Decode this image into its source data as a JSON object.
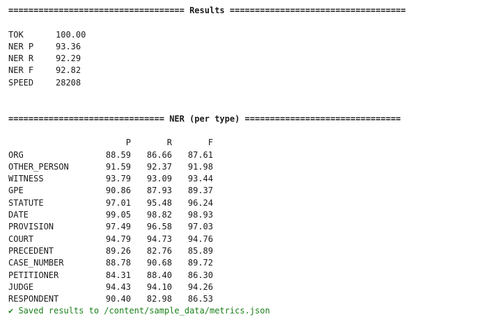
{
  "results_banner": "=================================== Results ===================================",
  "metrics": [
    {
      "key": "TOK",
      "value": "100.00"
    },
    {
      "key": "NER P",
      "value": "93.36"
    },
    {
      "key": "NER R",
      "value": "92.29"
    },
    {
      "key": "NER F",
      "value": "92.82"
    },
    {
      "key": "SPEED",
      "value": "28208"
    }
  ],
  "ner_banner": "=============================== NER (per type) ===============================",
  "per_type": {
    "headers": [
      "P",
      "R",
      "F"
    ],
    "rows": [
      {
        "label": "ORG",
        "p": "88.59",
        "r": "86.66",
        "f": "87.61"
      },
      {
        "label": "OTHER_PERSON",
        "p": "91.59",
        "r": "92.37",
        "f": "91.98"
      },
      {
        "label": "WITNESS",
        "p": "93.79",
        "r": "93.09",
        "f": "93.44"
      },
      {
        "label": "GPE",
        "p": "90.86",
        "r": "87.93",
        "f": "89.37"
      },
      {
        "label": "STATUTE",
        "p": "97.01",
        "r": "95.48",
        "f": "96.24"
      },
      {
        "label": "DATE",
        "p": "99.05",
        "r": "98.82",
        "f": "98.93"
      },
      {
        "label": "PROVISION",
        "p": "97.49",
        "r": "96.58",
        "f": "97.03"
      },
      {
        "label": "COURT",
        "p": "94.79",
        "r": "94.73",
        "f": "94.76"
      },
      {
        "label": "PRECEDENT",
        "p": "89.26",
        "r": "82.76",
        "f": "85.89"
      },
      {
        "label": "CASE_NUMBER",
        "p": "88.78",
        "r": "90.68",
        "f": "89.72"
      },
      {
        "label": "PETITIONER",
        "p": "84.31",
        "r": "88.40",
        "f": "86.30"
      },
      {
        "label": "JUDGE",
        "p": "94.43",
        "r": "94.10",
        "f": "94.26"
      },
      {
        "label": "RESPONDENT",
        "p": "90.40",
        "r": "82.98",
        "f": "86.53"
      }
    ]
  },
  "saved_message": "✔ Saved results to /content/sample_data/metrics.json",
  "colors": {
    "text": "#1a1a1a",
    "success": "#1a7f1a"
  }
}
